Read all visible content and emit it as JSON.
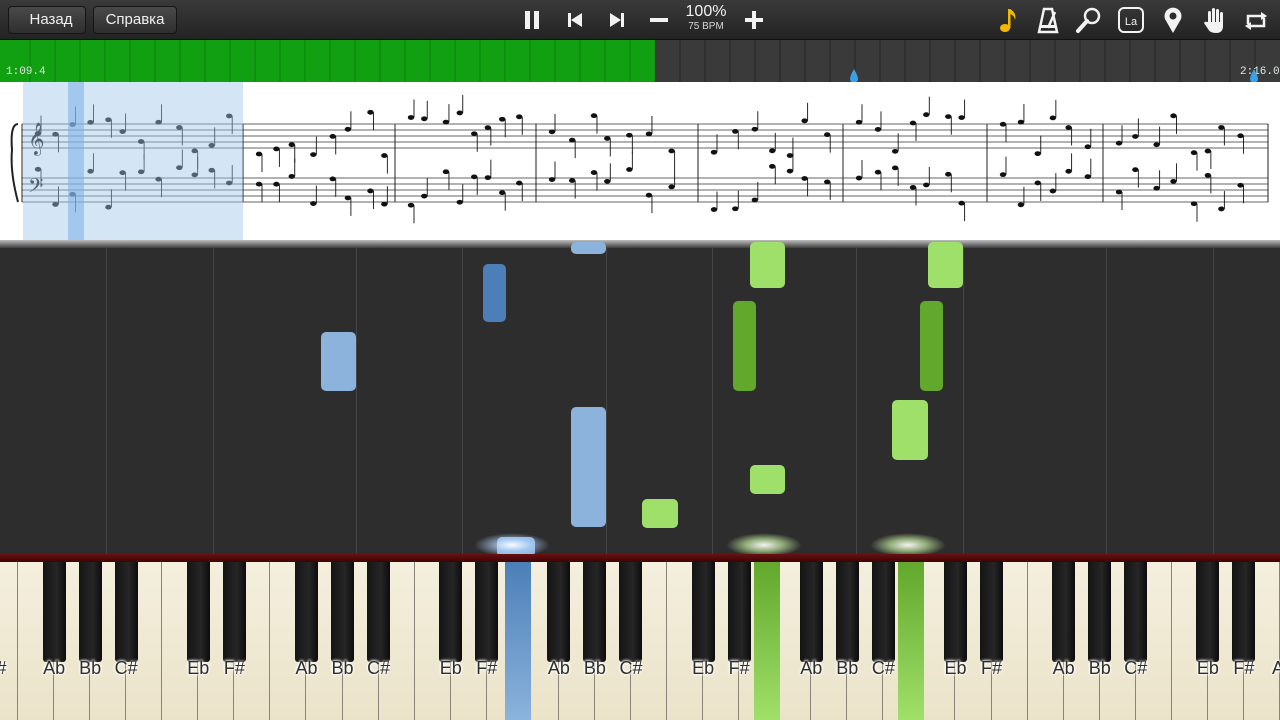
{
  "toolbar": {
    "back_label": "Назад",
    "help_label": "Справка",
    "controls": [
      "pause-icon",
      "skip-back-icon",
      "skip-forward-icon",
      "minus-icon",
      "plus-icon"
    ],
    "tempo_percent": "100%",
    "tempo_bpm": "75 BPM",
    "right_icons": [
      "music-note-icon",
      "metronome-icon",
      "magnifier-icon",
      "note-label-icon",
      "location-pin-icon",
      "hand-icon",
      "loop-icon"
    ],
    "note_label_text": "La"
  },
  "progress": {
    "current_time": "1:09.4",
    "total_time": "2:16.0",
    "played_fraction": 0.512,
    "loop_start_fraction": 0.667,
    "loop_end_fraction": 0.98,
    "played_color": "#11a011"
  },
  "colors": {
    "left_hand_light": "#8bb3dc",
    "left_hand_dark": "#4c7fb8",
    "right_hand_light": "#9fe06a",
    "right_hand_dark": "#62a82c"
  },
  "keyboard": {
    "black_key_labels": [
      "Ab",
      "Bb",
      "C#",
      "Eb",
      "F#",
      "Ab",
      "Bb",
      "C#",
      "Eb",
      "F#",
      "Ab",
      "Bb",
      "C#",
      "Eb",
      "F#",
      "Ab",
      "Bb",
      "C#",
      "Eb",
      "F#",
      "Ab",
      "Bb",
      "C#",
      "Eb",
      "F#"
    ],
    "partial_label_left": "F#",
    "partial_label_right": "A"
  }
}
